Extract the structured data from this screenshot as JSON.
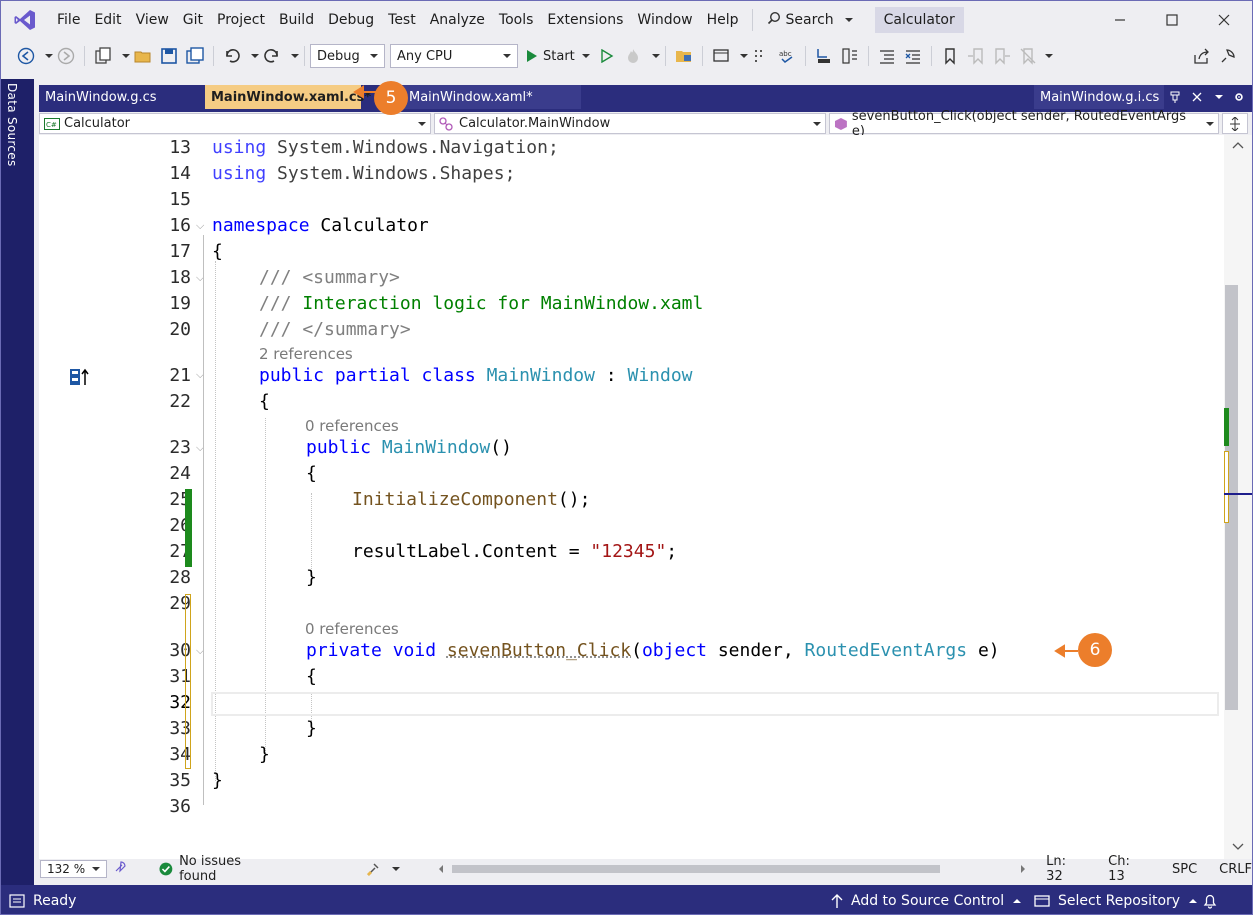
{
  "menu": {
    "items": [
      "File",
      "Edit",
      "View",
      "Git",
      "Project",
      "Build",
      "Debug",
      "Test",
      "Analyze",
      "Tools",
      "Extensions",
      "Window",
      "Help"
    ],
    "search_label": "Search",
    "solution_name": "Calculator"
  },
  "toolbar": {
    "config": "Debug",
    "platform": "Any CPU",
    "start_label": "Start"
  },
  "left_strip": {
    "label": "Data Sources"
  },
  "tabs": {
    "tab1": "MainWindow.g.cs",
    "tab2": "MainWindow.xaml.cs*",
    "tab3": "MainWindow.xaml*",
    "preview": "MainWindow.g.i.cs"
  },
  "navbar": {
    "project": "Calculator",
    "class": "Calculator.MainWindow",
    "member": "sevenButton_Click(object sender, RoutedEventArgs e)"
  },
  "code": {
    "lines": [
      "13",
      "14",
      "15",
      "16",
      "17",
      "18",
      "19",
      "20",
      "21",
      "22",
      "23",
      "24",
      "25",
      "26",
      "27",
      "28",
      "29",
      "30",
      "31",
      "32",
      "33",
      "34",
      "35",
      "36"
    ],
    "l13_kw": "using",
    "l13_rest": " System.Windows.Navigation;",
    "l14_kw": "using",
    "l14_rest": " System.Windows.Shapes;",
    "l16_kw": "namespace",
    "l16_rest": " Calculator",
    "l17": "{",
    "l18": "/// <summary>",
    "l19a": "/// ",
    "l19b": "Interaction logic for MainWindow.xaml",
    "l20": "/// </summary>",
    "lens_class": "2 references",
    "l21_kw": "public partial class",
    "l21_t1": "MainWindow",
    "l21_colon": " : ",
    "l21_t2": "Window",
    "l22": "{",
    "lens_ctor": "0 references",
    "l23_kw": "public",
    "l23_t": "MainWindow",
    "l23_rest": "()",
    "l24": "{",
    "l25_m": "InitializeComponent",
    "l25_rest": "();",
    "l27_a": "resultLabel.Content = ",
    "l27_s": "\"12345\"",
    "l27_b": ";",
    "l28": "}",
    "lens_handler": "0 references",
    "l30_kw": "private void",
    "l30_m": "sevenButton_Click",
    "l30_p1": "(",
    "l30_kw2": "object",
    "l30_p2": " sender, ",
    "l30_t": "RoutedEventArgs",
    "l30_p3": " e)",
    "l31": "{",
    "l33": "}",
    "l34": "}",
    "l35": "}"
  },
  "editor_status": {
    "zoom": "132 %",
    "issues": "No issues found",
    "ln": "Ln: 32",
    "ch": "Ch: 13",
    "spc": "SPC",
    "crlf": "CRLF"
  },
  "status": {
    "ready": "Ready",
    "source_control": "Add to Source Control",
    "repository": "Select Repository"
  },
  "callouts": {
    "c5": "5",
    "c6": "6"
  },
  "colors": {
    "accent": "#2b2d7d",
    "active_tab": "#f5cc84",
    "callout": "#ec7e2b",
    "keyword": "#0000ff",
    "type": "#2b91af",
    "comment": "#008000",
    "string": "#a31515",
    "method": "#74531f"
  }
}
